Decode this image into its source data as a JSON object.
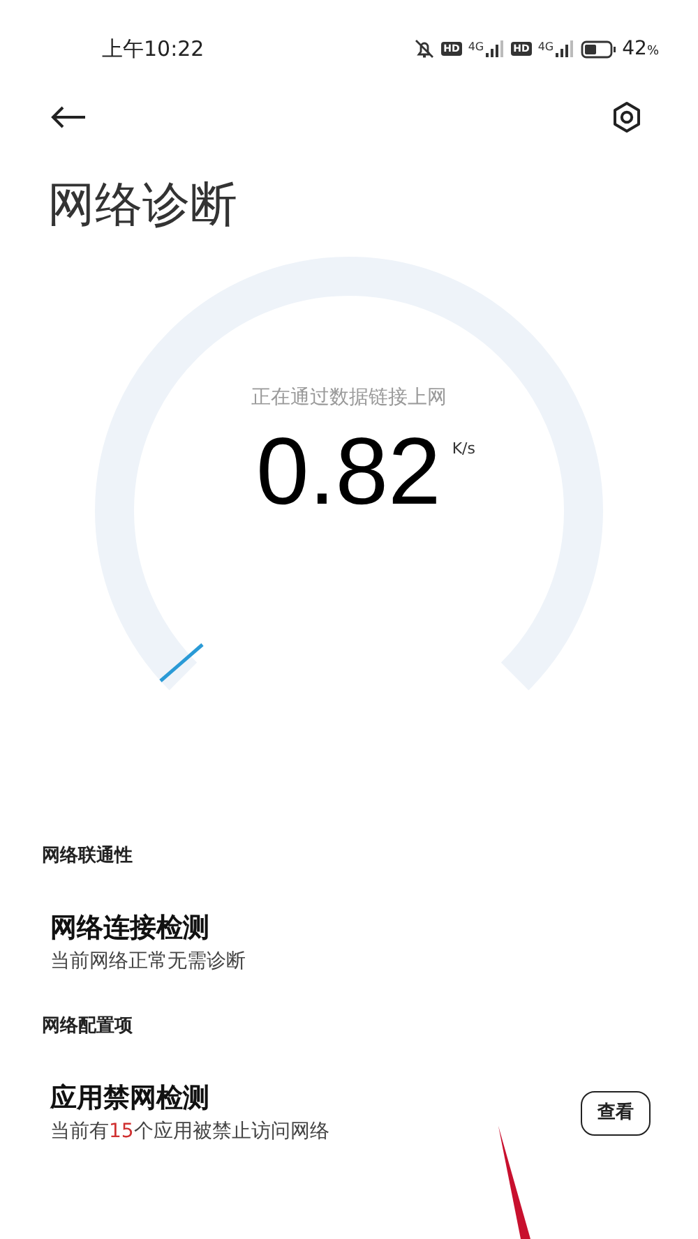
{
  "status_bar": {
    "time": "上午10:22",
    "battery_percent": "42",
    "battery_unit": "%",
    "sim1_network": "4G",
    "sim2_network": "4G",
    "hd_labels": [
      "HD",
      "HD"
    ]
  },
  "title": "网络诊断",
  "gauge": {
    "caption": "正在通过数据链接上网",
    "speed": "0.82",
    "unit": "K/s"
  },
  "sections": [
    {
      "header": "网络联通性",
      "items": [
        {
          "title": "网络连接检测",
          "subtitle_parts": [
            {
              "text": "当前网络正常无需诊断",
              "highlight": false
            }
          ]
        }
      ]
    },
    {
      "header": "网络配置项",
      "items": [
        {
          "title": "应用禁网检测",
          "subtitle_parts": [
            {
              "text": "当前有",
              "highlight": false
            },
            {
              "text": "15",
              "highlight": true
            },
            {
              "text": "个应用被禁止访问网络",
              "highlight": false
            }
          ],
          "button": "查看"
        }
      ]
    }
  ]
}
